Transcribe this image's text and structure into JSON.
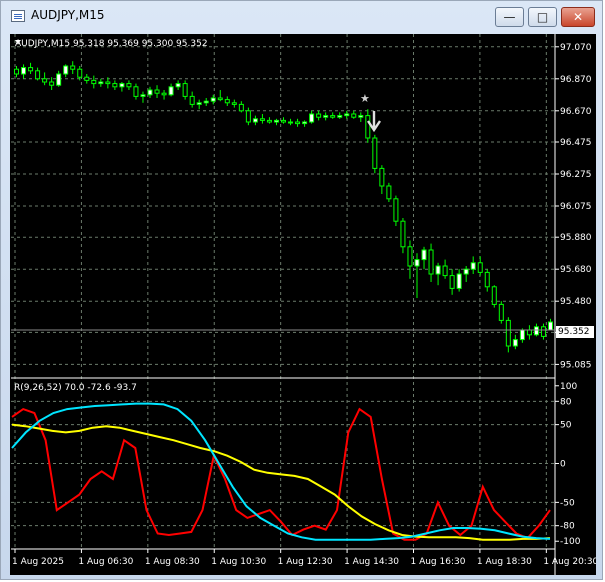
{
  "window": {
    "title": "AUDJPY,M15",
    "minimize_label": "—",
    "maximize_label": "□",
    "close_label": "✕"
  },
  "header": {
    "symbol_info": "AUDJPY,M15  95.318 95.369 95.300 95.352",
    "indicator_info": "R(9,26,52) 70.0 -72.6 -93.7"
  },
  "current_price": "95.352",
  "colors": {
    "background": "#000000",
    "grid": "#6b7b6b",
    "bull_candle": "#ffffff",
    "wick": "#00ff00",
    "line_fast": "#ff0000",
    "line_mid": "#ffff00",
    "line_slow": "#00e5ff",
    "arrow": "#e0e0e0"
  },
  "chart_data": [
    {
      "type": "candlestick",
      "title": "AUDJPY,M15",
      "ylim": [
        95.0,
        97.15
      ],
      "y_ticks": [
        "97.070",
        "96.870",
        "96.670",
        "96.475",
        "96.275",
        "96.075",
        "95.880",
        "95.680",
        "95.480",
        "95.285",
        "95.085"
      ],
      "x_ticks": [
        "1 Aug 2025",
        "1 Aug 06:30",
        "1 Aug 08:30",
        "1 Aug 10:30",
        "1 Aug 12:30",
        "1 Aug 14:30",
        "1 Aug 16:30",
        "1 Aug 18:30",
        "1 Aug 20:30"
      ],
      "current_price": 95.352,
      "ohlc": [
        [
          96.93,
          96.95,
          96.88,
          96.9
        ],
        [
          96.9,
          96.96,
          96.87,
          96.94
        ],
        [
          96.94,
          96.97,
          96.9,
          96.92
        ],
        [
          96.92,
          96.94,
          96.86,
          96.87
        ],
        [
          96.87,
          96.91,
          96.83,
          96.85
        ],
        [
          96.85,
          96.88,
          96.8,
          96.83
        ],
        [
          96.83,
          96.92,
          96.82,
          96.9
        ],
        [
          96.9,
          96.96,
          96.88,
          96.95
        ],
        [
          96.95,
          96.98,
          96.9,
          96.93
        ],
        [
          96.93,
          96.95,
          96.86,
          96.88
        ],
        [
          96.88,
          96.9,
          96.84,
          96.86
        ],
        [
          96.86,
          96.89,
          96.81,
          96.84
        ],
        [
          96.84,
          96.87,
          96.82,
          96.85
        ],
        [
          96.85,
          96.88,
          96.81,
          96.84
        ],
        [
          96.84,
          96.86,
          96.8,
          96.82
        ],
        [
          96.82,
          96.85,
          96.79,
          96.84
        ],
        [
          96.84,
          96.86,
          96.8,
          96.82
        ],
        [
          96.82,
          96.84,
          96.74,
          96.76
        ],
        [
          96.76,
          96.79,
          96.72,
          96.77
        ],
        [
          96.77,
          96.82,
          96.75,
          96.8
        ],
        [
          96.8,
          96.83,
          96.75,
          96.78
        ],
        [
          96.78,
          96.8,
          96.74,
          96.77
        ],
        [
          96.77,
          96.84,
          96.76,
          96.82
        ],
        [
          96.82,
          96.86,
          96.8,
          96.84
        ],
        [
          96.84,
          96.86,
          96.74,
          96.76
        ],
        [
          96.76,
          96.79,
          96.69,
          96.71
        ],
        [
          96.71,
          96.74,
          96.68,
          96.72
        ],
        [
          96.72,
          96.75,
          96.7,
          96.73
        ],
        [
          96.73,
          96.77,
          96.71,
          96.75
        ],
        [
          96.75,
          96.8,
          96.73,
          96.74
        ],
        [
          96.74,
          96.76,
          96.7,
          96.72
        ],
        [
          96.72,
          96.74,
          96.69,
          96.71
        ],
        [
          96.71,
          96.73,
          96.66,
          96.67
        ],
        [
          96.67,
          96.69,
          96.58,
          96.6
        ],
        [
          96.6,
          96.64,
          96.58,
          96.62
        ],
        [
          96.62,
          96.65,
          96.59,
          96.61
        ],
        [
          96.61,
          96.63,
          96.59,
          96.6
        ],
        [
          96.6,
          96.62,
          96.58,
          96.61
        ],
        [
          96.61,
          96.63,
          96.59,
          96.6
        ],
        [
          96.6,
          96.62,
          96.58,
          96.6
        ],
        [
          96.6,
          96.62,
          96.57,
          96.59
        ],
        [
          96.59,
          96.61,
          96.57,
          96.6
        ],
        [
          96.6,
          96.67,
          96.59,
          96.65
        ],
        [
          96.65,
          96.67,
          96.61,
          96.63
        ],
        [
          96.63,
          96.66,
          96.61,
          96.64
        ],
        [
          96.64,
          96.66,
          96.62,
          96.63
        ],
        [
          96.63,
          96.66,
          96.62,
          96.64
        ],
        [
          96.64,
          96.67,
          96.62,
          96.65
        ],
        [
          96.65,
          96.67,
          96.62,
          96.63
        ],
        [
          96.63,
          96.66,
          96.6,
          96.64
        ],
        [
          96.64,
          96.68,
          96.47,
          96.5
        ],
        [
          96.5,
          96.52,
          96.28,
          96.31
        ],
        [
          96.31,
          96.33,
          96.15,
          96.2
        ],
        [
          96.2,
          96.22,
          96.1,
          96.12
        ],
        [
          96.12,
          96.14,
          95.95,
          95.98
        ],
        [
          95.98,
          96.0,
          95.78,
          95.82
        ],
        [
          95.82,
          95.86,
          95.62,
          95.7
        ],
        [
          95.7,
          95.78,
          95.5,
          95.74
        ],
        [
          95.74,
          95.82,
          95.68,
          95.8
        ],
        [
          95.8,
          95.84,
          95.6,
          95.65
        ],
        [
          95.65,
          95.72,
          95.58,
          95.7
        ],
        [
          95.7,
          95.74,
          95.62,
          95.64
        ],
        [
          95.64,
          95.68,
          95.52,
          95.56
        ],
        [
          95.56,
          95.68,
          95.54,
          95.65
        ],
        [
          95.65,
          95.7,
          95.6,
          95.68
        ],
        [
          95.68,
          95.76,
          95.65,
          95.72
        ],
        [
          95.72,
          95.76,
          95.64,
          95.66
        ],
        [
          95.66,
          95.68,
          95.54,
          95.57
        ],
        [
          95.57,
          95.58,
          95.44,
          95.46
        ],
        [
          95.46,
          95.48,
          95.34,
          95.36
        ],
        [
          95.36,
          95.38,
          95.16,
          95.2
        ],
        [
          95.2,
          95.27,
          95.18,
          95.24
        ],
        [
          95.24,
          95.31,
          95.22,
          95.3
        ],
        [
          95.3,
          95.33,
          95.24,
          95.27
        ],
        [
          95.27,
          95.34,
          95.26,
          95.32
        ],
        [
          95.32,
          95.34,
          95.24,
          95.26
        ],
        [
          95.3,
          95.37,
          95.3,
          95.35
        ]
      ],
      "annotation": "sell-arrow"
    },
    {
      "type": "line",
      "title": "R(9,26,52) 70.0 -72.6 -93.7",
      "ylim": [
        -110,
        110
      ],
      "y_ticks": [
        100,
        80,
        50,
        0,
        -50,
        -80,
        -100
      ],
      "series": [
        {
          "values": [
            60,
            70,
            65,
            30,
            -60,
            -50,
            -40,
            -20,
            -10,
            -20,
            30,
            20,
            -60,
            -90,
            -92,
            -90,
            -88,
            -60,
            10,
            -20,
            -60,
            -70,
            -65,
            -60,
            -75,
            -92,
            -85,
            -80,
            -85,
            -60,
            40,
            70,
            60,
            -20,
            -90,
            -98,
            -98,
            -90,
            -50,
            -80,
            -92,
            -80,
            -30,
            -60,
            -75,
            -90,
            -96,
            -80,
            -60
          ]
        },
        {
          "values": [
            50,
            48,
            45,
            42,
            40,
            42,
            46,
            48,
            46,
            42,
            38,
            34,
            30,
            25,
            20,
            16,
            10,
            2,
            -8,
            -12,
            -14,
            -16,
            -20,
            -30,
            -40,
            -55,
            -68,
            -78,
            -86,
            -92,
            -94,
            -95,
            -95,
            -95,
            -96,
            -98,
            -98,
            -98,
            -97,
            -97,
            -96
          ]
        },
        {
          "values": [
            20,
            40,
            55,
            65,
            70,
            72,
            74,
            75,
            76,
            77,
            77,
            76,
            70,
            55,
            30,
            0,
            -30,
            -55,
            -70,
            -80,
            -90,
            -95,
            -98,
            -98,
            -98,
            -98,
            -98,
            -97,
            -96,
            -94,
            -90,
            -86,
            -83,
            -83,
            -84,
            -86,
            -90,
            -94,
            -96,
            -97
          ]
        }
      ]
    }
  ]
}
